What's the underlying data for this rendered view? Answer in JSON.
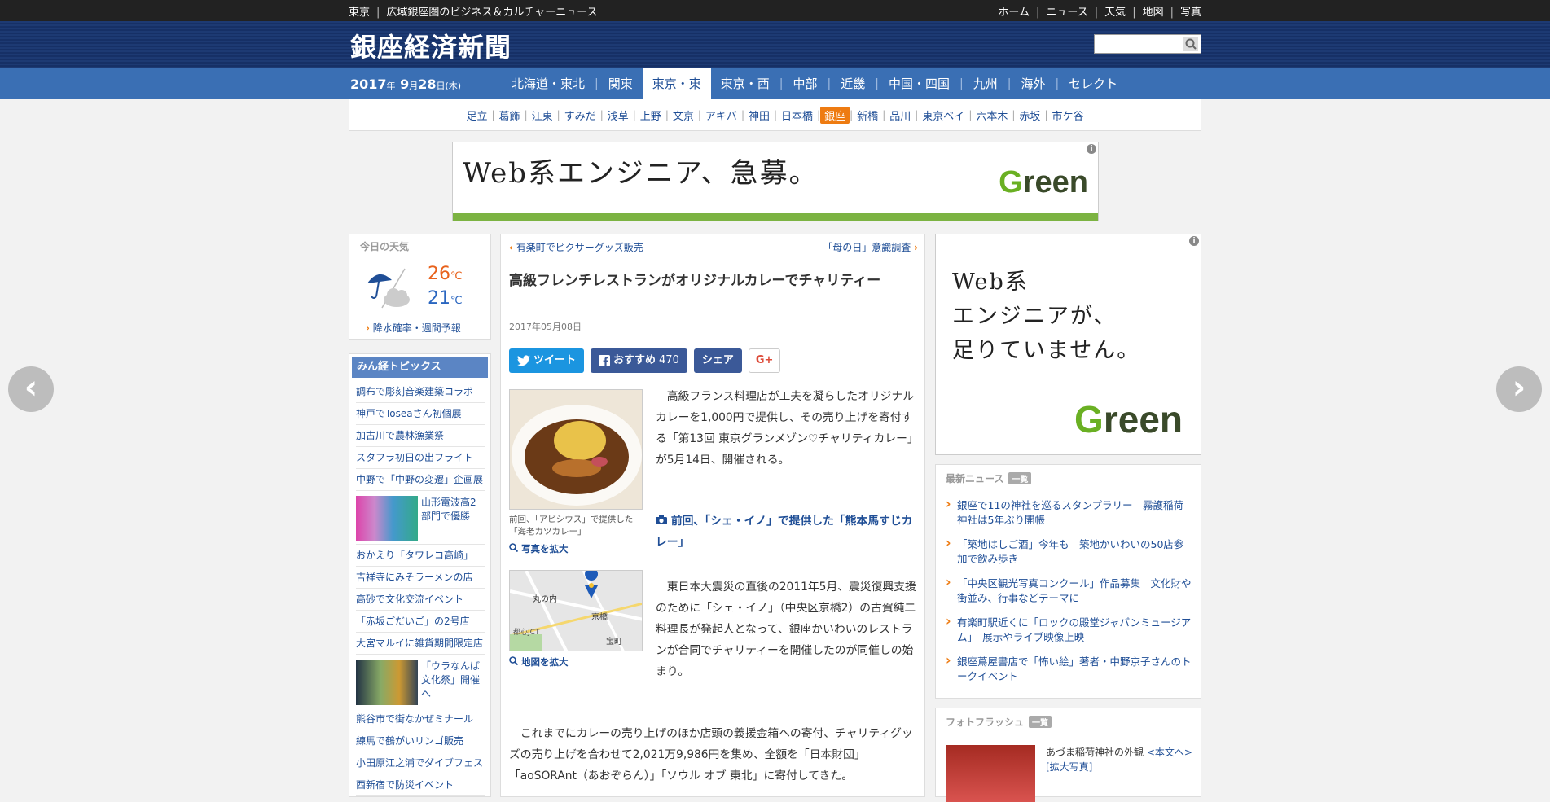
{
  "topbar": {
    "region": "東京",
    "tagline": "広域銀座圏のビジネス＆カルチャーニュース",
    "links": [
      "ホーム",
      "ニュース",
      "天気",
      "地図",
      "写真"
    ]
  },
  "masthead": {
    "logo": "銀座経済新聞",
    "search_placeholder": ""
  },
  "date": {
    "year": "2017",
    "year_unit": "年",
    "month": "9",
    "month_unit": "月",
    "day": "28",
    "day_unit": "日",
    "weekday": "(木)"
  },
  "regions": [
    "北海道・東北",
    "関東",
    "東京・東",
    "東京・西",
    "中部",
    "近畿",
    "中国・四国",
    "九州",
    "海外",
    "セレクト"
  ],
  "active_region": "東京・東",
  "areas": [
    "足立",
    "葛飾",
    "江東",
    "すみだ",
    "浅草",
    "上野",
    "文京",
    "アキバ",
    "神田",
    "日本橋",
    "銀座",
    "新橋",
    "品川",
    "東京ベイ",
    "六本木",
    "赤坂",
    "市ケ谷"
  ],
  "active_area": "銀座",
  "ad_top": {
    "copy": "Web系エンジニア、急募。",
    "brand_g": "G",
    "brand_rest": "reen",
    "info": "i"
  },
  "weather": {
    "heading": "今日の天気",
    "high": "26",
    "low": "21",
    "unit": "℃",
    "link": "降水確率・週間予報"
  },
  "topics": {
    "heading": "みん経トピックス",
    "items": [
      "調布で彫刻音楽建築コラボ",
      "神戸でToseaさん初個展",
      "加古川で農林漁業祭",
      "スタフラ初日の出フライト",
      "中野で「中野の変遷」企画展",
      "山形電波高2部門で優勝",
      "おかえり「タワレコ高崎」",
      "吉祥寺にみそラーメンの店",
      "高砂で文化交流イベント",
      "「赤坂ごだいご」の2号店",
      "大宮マルイに雑貨期間限定店",
      "「ウラなんば文化祭」開催へ",
      "熊谷市で街なかぜミナール",
      "練馬で鶴がいリンゴ販売",
      "小田原江之浦でダイブフェス",
      "西新宿で防災イベント"
    ]
  },
  "article": {
    "prev_link": "有楽町でピクサーグッズ販売",
    "next_link": "「母の日」意識調査",
    "title": "高級フレンチレストランがオリジナルカレーでチャリティー",
    "date": "2017年05月08日",
    "share": {
      "tweet": "ツイート",
      "recommend": "おすすめ",
      "recommend_count": "470",
      "share": "シェア",
      "gplus": "G+"
    },
    "photo_caption": "前回、「アピシウス」で提供した「海老カツカレー」",
    "photo_zoom": "写真を拡大",
    "map_zoom": "地図を拡大",
    "map_labels": {
      "a": "丸の内",
      "b": "京橋",
      "c": "宝町",
      "d": "都心JCT"
    },
    "p1": "高級フランス料理店が工夫を凝らしたオリジナルカレーを1,000円で提供し、その売り上げを寄付する「第13回 東京グランメゾン♡チャリティカレー」が5月14日、開催される。",
    "photo_link": "前回、「シェ・イノ」で提供した「熊本馬すじカレー」",
    "p2": "東日本大震災の直後の2011年5月、震災復興支援のために「シェ・イノ」（中央区京橋2）の古賀純二料理長が発起人となって、銀座かいわいのレストランが合同でチャリティーを開催したのが同催しの始まり。",
    "p3": "これまでにカレーの売り上げのほか店頭の義援金箱への寄付、チャリティグッズの売り上げを合わせて2,021万9,986円を集め、全額を「日本財団」「aoSORAnt（あおぞらん）」「ソウル オブ 東北」に寄付してきた。"
  },
  "ad_side": {
    "copy_lines": [
      "Web系",
      "エンジニアが、",
      "足りていません。"
    ],
    "brand_g": "G",
    "brand_rest": "reen",
    "info": "i"
  },
  "news": {
    "heading": "最新ニュース",
    "tag": "一覧",
    "items": [
      "銀座で11の神社を巡るスタンプラリー　霧護稲荷神社は5年ぶり開帳",
      "「築地はしご酒」今年も　築地かいわいの50店参加で飲み歩き",
      "「中央区観光写真コンクール」作品募集　文化財や街並み、行事などテーマに",
      "有楽町駅近くに「ロックの殿堂ジャパンミュージアム」　展示やライブ映像上映",
      "銀座蔦屋書店で「怖い絵」著者・中野京子さんのトークイベント"
    ]
  },
  "photoflash": {
    "heading": "フォトフラッシュ",
    "tag": "一覧",
    "caption": "あづま稲荷神社の外観",
    "more": "<本文へ>",
    "zoom": "[拡大写真]"
  },
  "nav_arrows": {
    "prev": "‹",
    "next": "›"
  }
}
